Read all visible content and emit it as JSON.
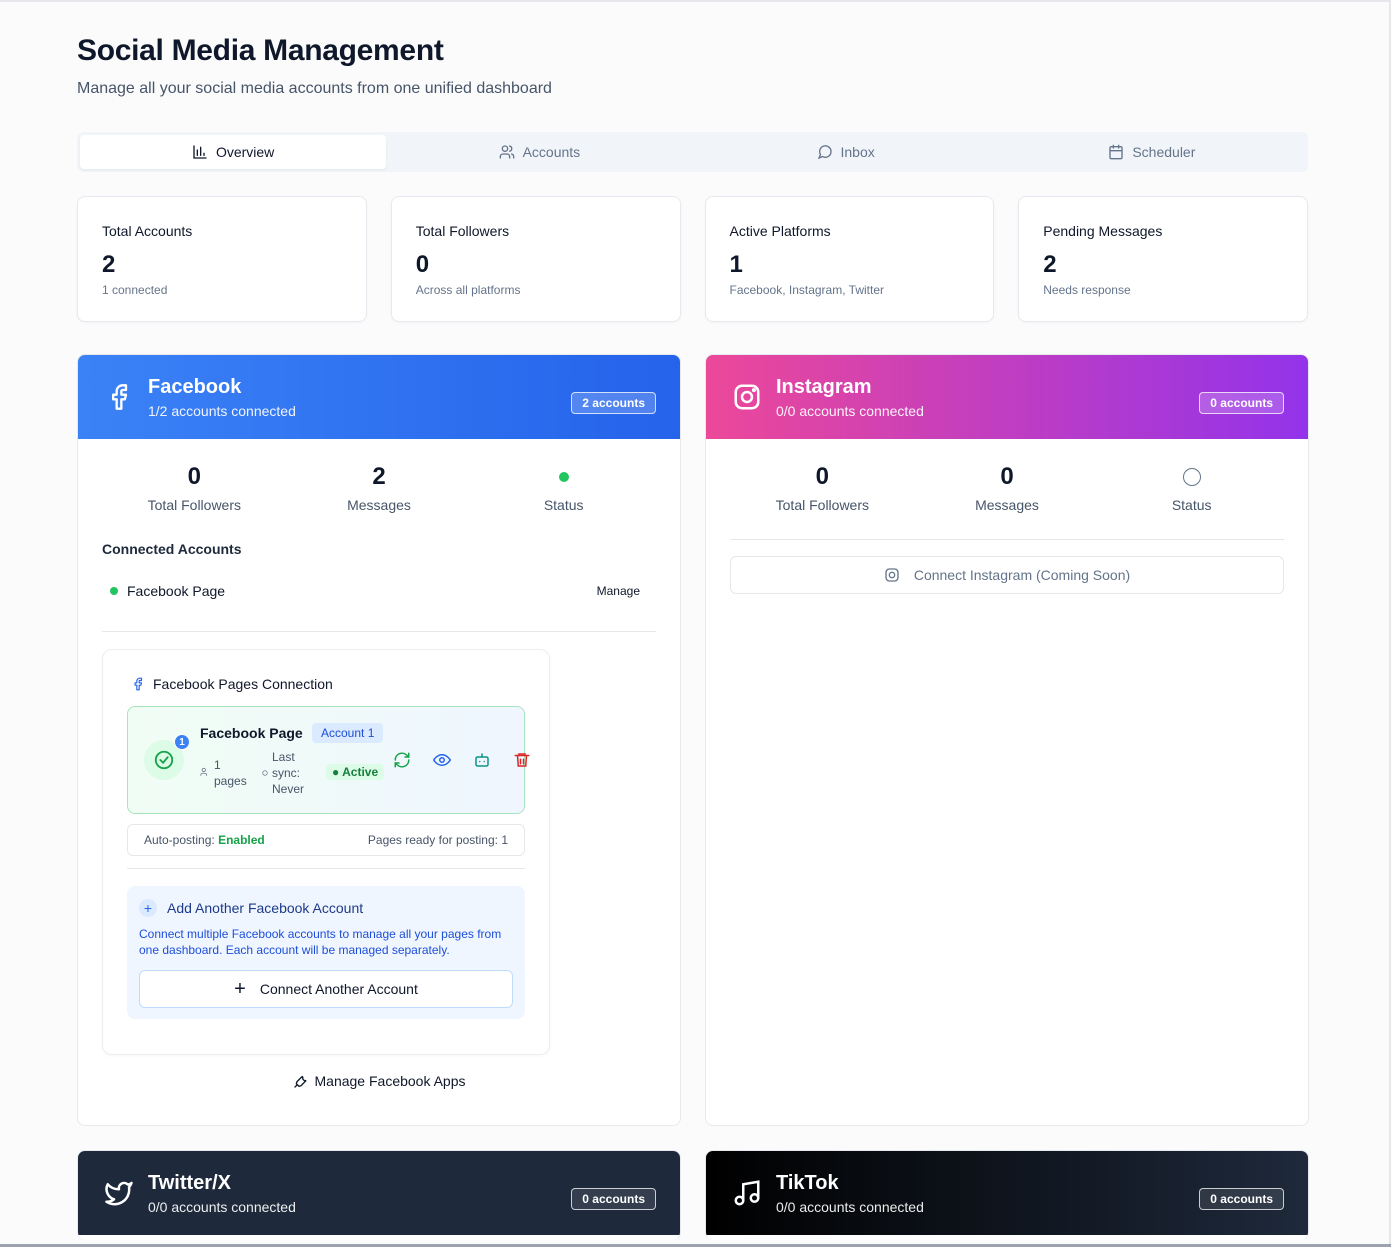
{
  "header": {
    "title": "Social Media Management",
    "subtitle": "Manage all your social media accounts from one unified dashboard"
  },
  "tabs": [
    {
      "label": "Overview",
      "icon": "bar-chart-icon",
      "active": true
    },
    {
      "label": "Accounts",
      "icon": "users-icon",
      "active": false
    },
    {
      "label": "Inbox",
      "icon": "message-circle-icon",
      "active": false
    },
    {
      "label": "Scheduler",
      "icon": "calendar-icon",
      "active": false
    }
  ],
  "stats": [
    {
      "label": "Total Accounts",
      "value": "2",
      "sub": "1 connected"
    },
    {
      "label": "Total Followers",
      "value": "0",
      "sub": "Across all platforms"
    },
    {
      "label": "Active Platforms",
      "value": "1",
      "sub": "Facebook, Instagram, Twitter"
    },
    {
      "label": "Pending Messages",
      "value": "2",
      "sub": "Needs response"
    }
  ],
  "facebook": {
    "name": "Facebook",
    "connected": "1/2 accounts connected",
    "badge": "2 accounts",
    "metrics": [
      {
        "value": "0",
        "label": "Total Followers"
      },
      {
        "value": "2",
        "label": "Messages"
      },
      {
        "value": "",
        "label": "Status",
        "status_color": "#22c55e"
      }
    ],
    "connected_title": "Connected Accounts",
    "account_name": "Facebook Page",
    "manage_label": "Manage",
    "pages_connection_title": "Facebook Pages Connection",
    "page_tile": {
      "title": "Facebook Page",
      "account_badge": "Account 1",
      "number_badge": "1",
      "pages_count": "1",
      "pages_word": "pages",
      "last_sync_label": "Last",
      "last_sync_label2": "sync:",
      "last_sync_value": "Never",
      "status": "● Active"
    },
    "autopost_label": "Auto-posting:",
    "autopost_value": "Enabled",
    "pages_ready": "Pages ready for posting: 1",
    "add_another": {
      "title": "Add Another Facebook Account",
      "description": "Connect multiple Facebook accounts to manage all your pages from one dashboard. Each account will be managed separately.",
      "button": "Connect Another Account"
    },
    "manage_apps": "Manage Facebook Apps"
  },
  "instagram": {
    "name": "Instagram",
    "connected": "0/0 accounts connected",
    "badge": "0 accounts",
    "metrics": [
      {
        "value": "0",
        "label": "Total Followers"
      },
      {
        "value": "0",
        "label": "Messages"
      },
      {
        "value": "",
        "label": "Status"
      }
    ],
    "connect_button": "Connect Instagram (Coming Soon)"
  },
  "twitter": {
    "name": "Twitter/X",
    "connected": "0/0 accounts connected",
    "badge": "0 accounts"
  },
  "tiktok": {
    "name": "TikTok",
    "connected": "0/0 accounts connected",
    "badge": "0 accounts"
  },
  "colors": {
    "facebook_gradient": [
      "#3b82f6",
      "#2563eb"
    ],
    "instagram_gradient": [
      "#ec4899",
      "#9333ea"
    ],
    "twitter_header": "#1e293b",
    "tiktok_gradient": [
      "#000000",
      "#1e293b"
    ],
    "active_green": "#22c55e"
  }
}
